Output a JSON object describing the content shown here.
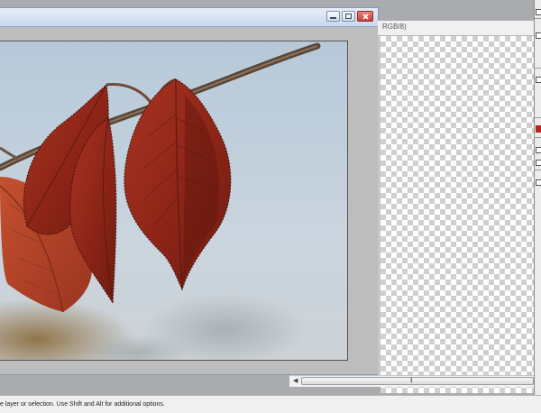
{
  "document_a": {
    "controls": {
      "minimize_icon": "minimize-icon",
      "restore_icon": "restore-icon",
      "close_icon": "close-icon"
    }
  },
  "document_b": {
    "title_fragment": "RGB/8)"
  },
  "statusbar": {
    "hint": "e layer or selection.  Use Shift and Alt for additional options."
  },
  "colors": {
    "workspace": "#a9abae",
    "titlebar": "#c9d8ec",
    "close_button": "#c44032",
    "leaf": "#9c2a1a",
    "sky": "#c3d1dd"
  }
}
